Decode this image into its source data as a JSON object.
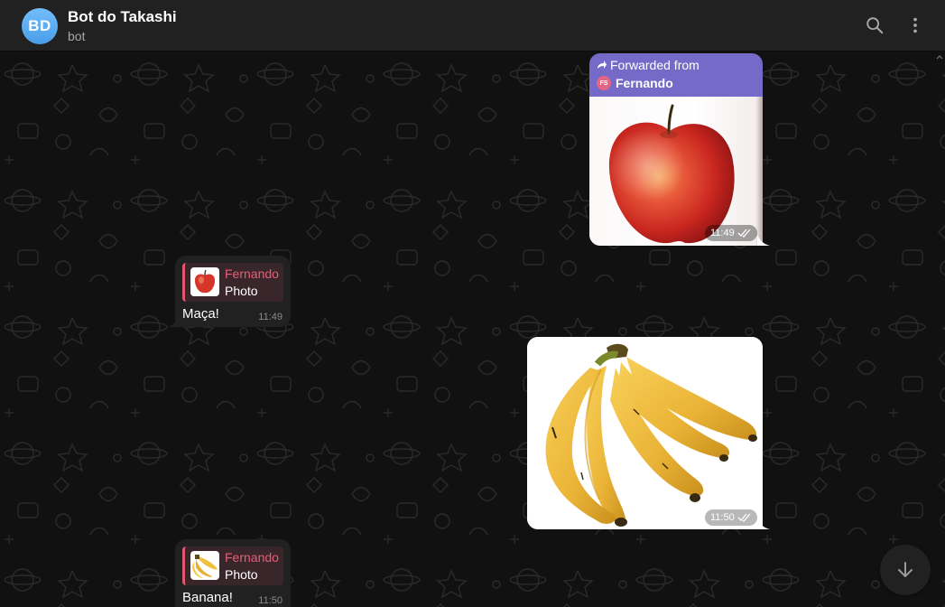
{
  "header": {
    "avatar_initials": "BD",
    "title": "Bot do Takashi",
    "subtitle": "bot",
    "search_icon": "search-icon",
    "menu_icon": "more-vertical-icon"
  },
  "messages": [
    {
      "direction": "outgoing",
      "forwarded_label": "Forwarded from",
      "forwarded_avatar_initials": "FS",
      "forwarded_name": "Fernando",
      "media": "apple-photo",
      "time": "11:49",
      "status_icon": "double-check-icon"
    },
    {
      "direction": "incoming",
      "reply_name": "Fernando",
      "reply_kind": "Photo",
      "reply_thumb": "apple-thumb",
      "text": "Maça!",
      "time": "11:49"
    },
    {
      "direction": "outgoing",
      "media": "banana-photo",
      "time": "11:50",
      "status_icon": "double-check-icon"
    },
    {
      "direction": "incoming",
      "reply_name": "Fernando",
      "reply_kind": "Photo",
      "reply_thumb": "banana-thumb",
      "text": "Banana!",
      "time": "11:50"
    }
  ],
  "scroll_down_icon": "arrow-down-icon",
  "colors": {
    "header_bg": "#212121",
    "chat_bg": "#111111",
    "outgoing_accent": "#766ac8",
    "incoming_bubble": "#212121",
    "reply_accent": "#e3566f",
    "avatar": "#5ea9f1"
  }
}
